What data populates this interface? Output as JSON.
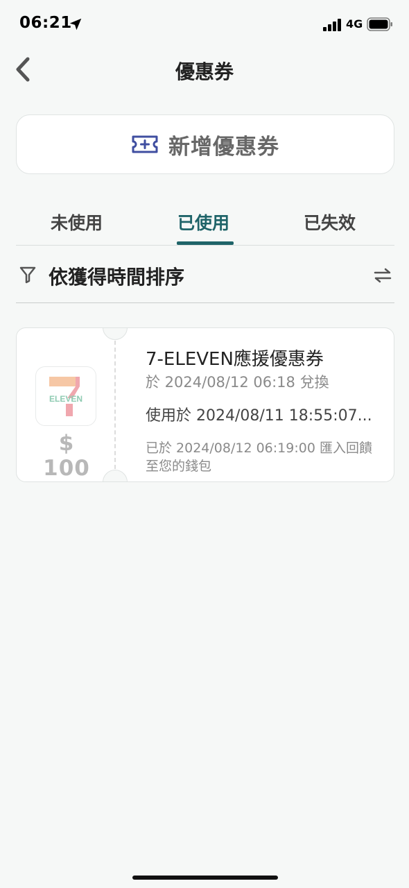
{
  "status_bar": {
    "time": "06:21",
    "network": "4G"
  },
  "header": {
    "title": "優惠券"
  },
  "add_coupon": {
    "label": "新增優惠券"
  },
  "tabs": [
    {
      "label": "未使用",
      "active": false
    },
    {
      "label": "已使用",
      "active": true
    },
    {
      "label": "已失效",
      "active": false
    }
  ],
  "sort": {
    "label": "依獲得時間排序"
  },
  "coupons": [
    {
      "name": "7-ELEVEN應援優惠券",
      "amount": "$ 100",
      "redeemed": "於 2024/08/12 06:18 兌換",
      "used": "使用於 2024/08/11 18:55:07...",
      "note": "已於 2024/08/12 06:19:00 匯入回饋至您的錢包",
      "brand_logo_text": "ELEVEN"
    }
  ],
  "colors": {
    "accent": "#1f6469",
    "background": "#f6f8f7"
  }
}
